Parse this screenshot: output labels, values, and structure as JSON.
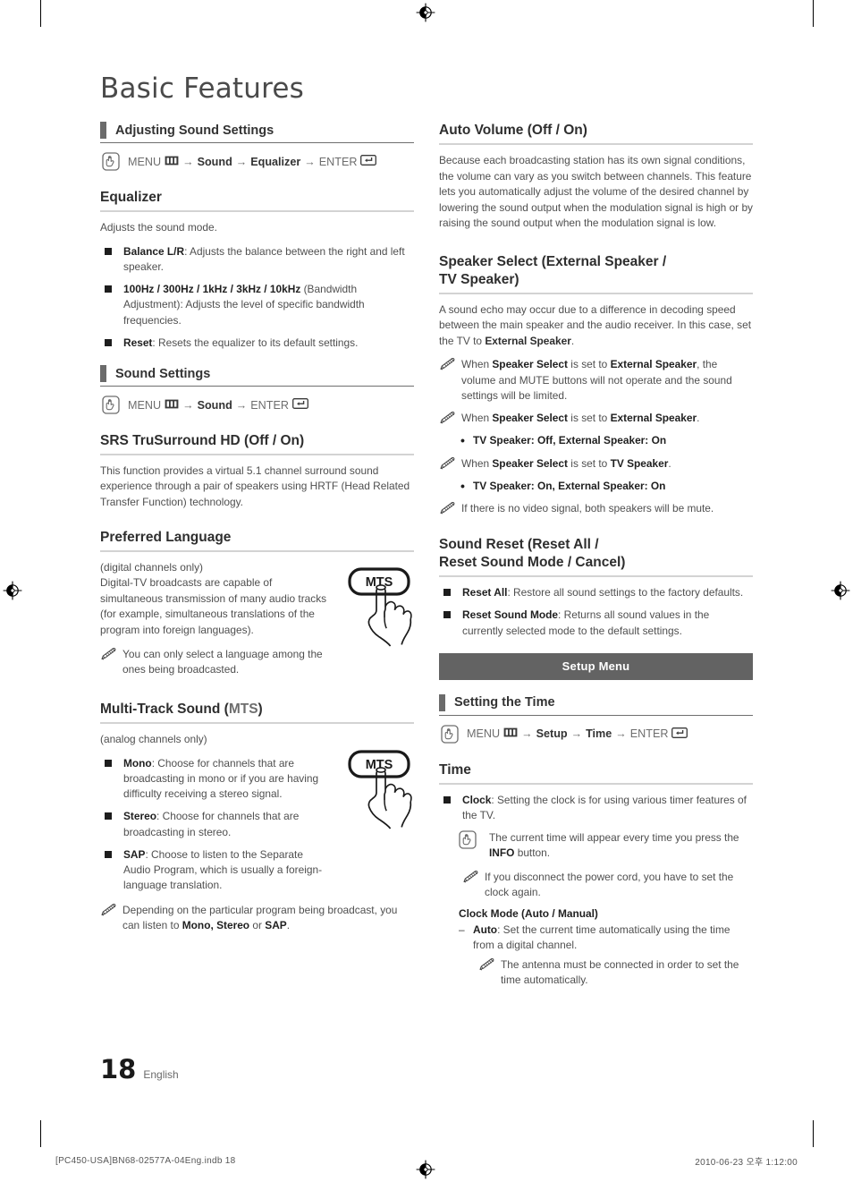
{
  "page": {
    "title": "Basic Features",
    "number": "18",
    "language": "English"
  },
  "footer": {
    "file": "[PC450-USA]BN68-02577A-04Eng.indb   18",
    "timestamp": "2010-06-23   오후 1:12:00"
  },
  "left_column": {
    "section_adjusting_sound": {
      "heading": "Adjusting Sound Settings",
      "path": {
        "menu": "MENU",
        "arrow": "→",
        "steps": [
          "Sound",
          "Equalizer"
        ],
        "enter": "ENTER"
      }
    },
    "equalizer": {
      "heading": "Equalizer",
      "intro": "Adjusts the sound mode.",
      "bullets": [
        {
          "label": "Balance L/R",
          "text": ": Adjusts the balance between the right and left speaker."
        },
        {
          "label": "100Hz / 300Hz / 1kHz / 3kHz / 10kHz",
          "text": " (Bandwidth Adjustment): Adjusts the level of specific bandwidth frequencies."
        },
        {
          "label": "Reset",
          "text": ": Resets the equalizer to its default settings."
        }
      ]
    },
    "section_sound_settings": {
      "heading": "Sound Settings",
      "path": {
        "menu": "MENU",
        "arrow": "→",
        "steps": [
          "Sound"
        ],
        "enter": "ENTER"
      }
    },
    "srs": {
      "heading": "SRS TruSurround HD (Off / On)",
      "body": "This function provides a virtual 5.1 channel surround sound experience through a pair of speakers using HRTF (Head Related Transfer Function) technology."
    },
    "preferred_language": {
      "heading": "Preferred Language",
      "note_channels": "(digital channels only)",
      "body": "Digital-TV broadcasts are capable of simultaneous transmission of many audio tracks (for example, simultaneous translations of the program into foreign languages).",
      "note": "You can only select a language among the ones being broadcasted.",
      "button_label": "MTS"
    },
    "mts": {
      "heading_main": "Multi-Track Sound (",
      "heading_light": "MTS",
      "heading_end": ")",
      "note_channels": "(analog channels only)",
      "bullets": [
        {
          "label": "Mono",
          "text": ": Choose for channels that are broadcasting in mono or if you are having difficulty receiving a stereo signal."
        },
        {
          "label": "Stereo",
          "text": ": Choose for channels that are broadcasting in stereo."
        },
        {
          "label": "SAP",
          "text": ": Choose to listen to the Separate Audio Program, which is usually a foreign-language translation."
        }
      ],
      "note_pre": "Depending on the particular program being broadcast, you can listen to ",
      "note_bold1": "Mono, Stereo",
      "note_mid": " or ",
      "note_bold2": "SAP",
      "note_end": ".",
      "button_label": "MTS"
    }
  },
  "right_column": {
    "auto_volume": {
      "heading": "Auto Volume (Off / On)",
      "body": "Because each broadcasting station has its own signal conditions, the volume can vary as you switch between channels. This feature lets you automatically adjust the volume of the desired channel by lowering the sound output when the modulation signal is high or by raising the sound output when the modulation signal is low."
    },
    "speaker_select": {
      "heading_line1": "Speaker Select (External Speaker /",
      "heading_line2": "TV Speaker)",
      "body_pre": "A sound echo may occur due to a difference in decoding speed between the main speaker and the audio receiver. In this case, set the TV to ",
      "body_bold": "External Speaker",
      "body_end": ".",
      "notes": [
        {
          "pre": "When ",
          "b1": "Speaker Select",
          "mid": " is set to ",
          "b2": "External Speaker",
          "end": ", the volume and MUTE buttons will not operate and the sound settings will be limited."
        },
        {
          "pre": "When ",
          "b1": "Speaker Select",
          "mid": " is set to ",
          "b2": "External Speaker",
          "end": "."
        },
        {
          "pre": "When ",
          "b1": "Speaker Select",
          "mid": " is set to ",
          "b2": "TV Speaker",
          "end": "."
        }
      ],
      "dot1": "TV Speaker: Off, External Speaker: On",
      "dot2": "TV Speaker: On, External Speaker: On",
      "note_final": "If there is no video signal, both speakers will be mute."
    },
    "sound_reset": {
      "heading_line1": "Sound Reset (Reset All /",
      "heading_line2": "Reset Sound Mode / Cancel)",
      "bullets": [
        {
          "label": "Reset All",
          "text": ": Restore all sound settings to the factory defaults."
        },
        {
          "label": "Reset Sound Mode",
          "text": ": Returns all sound values in the currently selected mode to the default settings."
        }
      ]
    },
    "banner": "Setup Menu",
    "setting_time": {
      "heading": "Setting the Time",
      "path": {
        "menu": "MENU",
        "arrow": "→",
        "steps": [
          "Setup",
          "Time"
        ],
        "enter": "ENTER"
      }
    },
    "time": {
      "heading": "Time",
      "clock_label": "Clock",
      "clock_text": ": Setting the clock is for using various timer features of the TV.",
      "hand_note_pre": "The current time will appear every time you press the ",
      "hand_note_bold": "INFO",
      "hand_note_end": " button.",
      "pencil_note": "If you disconnect the power cord, you have to set the clock again.",
      "clock_mode_label": "Clock Mode (Auto / Manual)",
      "auto_label": "Auto",
      "auto_text": ": Set the current time automatically using the time from a digital channel.",
      "auto_note": "The antenna must be connected in order to set the time automatically."
    }
  },
  "icons": {
    "hand_press": "hand-press-icon",
    "menu_glyph": "menu-glyph-icon",
    "enter_glyph": "enter-key-icon",
    "pencil": "pencil-note-icon",
    "registration": "registration-mark",
    "mts_button": "mts-remote-button-illustration"
  },
  "colors": {
    "banner_bg": "#636363",
    "section_tick": "#6b6b6b",
    "rule_grey": "#d3d3d3",
    "body_text": "#4f4f4f"
  }
}
